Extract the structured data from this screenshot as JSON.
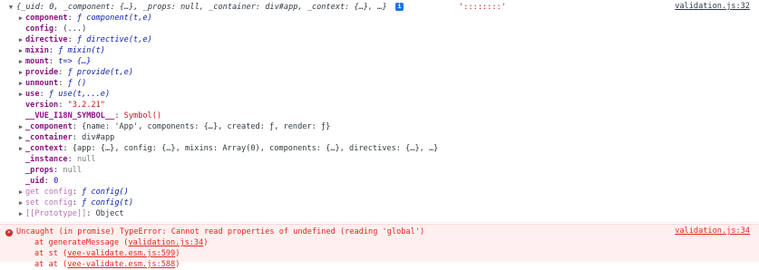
{
  "summary": {
    "text": "{_uid: 0, _component: {…}, _props: null, _container: div#app, _context: {…}, …}",
    "info_badge": "i",
    "trailing": "'::::::::'",
    "source": "validation.js:32"
  },
  "props": [
    {
      "key": "component",
      "value": "ƒ component(t,e)",
      "arrow": "▶",
      "kind": "func"
    },
    {
      "key": "config",
      "value": "(...)",
      "arrow": "",
      "kind": "plain"
    },
    {
      "key": "directive",
      "value": "ƒ directive(t,e)",
      "arrow": "▶",
      "kind": "func"
    },
    {
      "key": "mixin",
      "value": "ƒ mixin(t)",
      "arrow": "▶",
      "kind": "func"
    },
    {
      "key": "mount",
      "value": "t=> {…}",
      "arrow": "▶",
      "kind": "func"
    },
    {
      "key": "provide",
      "value": "ƒ provide(t,e)",
      "arrow": "▶",
      "kind": "func"
    },
    {
      "key": "unmount",
      "value": "ƒ ()",
      "arrow": "▶",
      "kind": "func"
    },
    {
      "key": "use",
      "value": "ƒ use(t,...e)",
      "arrow": "▶",
      "kind": "func"
    },
    {
      "key": "version",
      "value": "\"3.2.21\"",
      "arrow": "",
      "kind": "str"
    },
    {
      "key": "__VUE_I18N_SYMBOL__",
      "value": "Symbol()",
      "arrow": "",
      "kind": "sym"
    },
    {
      "key": "_component",
      "value": "{name: 'App', components: {…}, created: ƒ, render: ƒ}",
      "arrow": "▶",
      "kind": "plain"
    },
    {
      "key": "_container",
      "value": "div#app",
      "arrow": "▶",
      "kind": "plain"
    },
    {
      "key": "_context",
      "value": "{app: {…}, config: {…}, mixins: Array(0), components: {…}, directives: {…}, …}",
      "arrow": "▶",
      "kind": "plain"
    },
    {
      "key": "_instance",
      "value": "null",
      "arrow": "",
      "kind": "null"
    },
    {
      "key": "_props",
      "value": "null",
      "arrow": "",
      "kind": "null"
    },
    {
      "key": "_uid",
      "value": "0",
      "arrow": "",
      "kind": "num"
    },
    {
      "key": "get config",
      "value": "ƒ config()",
      "arrow": "▶",
      "kind": "getter"
    },
    {
      "key": "set config",
      "value": "ƒ config(t)",
      "arrow": "▶",
      "kind": "getter"
    },
    {
      "key": "[[Prototype]]",
      "value": "Object",
      "arrow": "▶",
      "kind": "proto"
    }
  ],
  "error": {
    "message": "Uncaught (in promise) TypeError: Cannot read properties of undefined (reading 'global')",
    "icon": "✕",
    "source": "validation.js:34",
    "stack": [
      {
        "prefix": "at generateMessage (",
        "link": "validation.js:34",
        "suffix": ")"
      },
      {
        "prefix": "at st (",
        "link": "vee-validate.esm.js:599",
        "suffix": ")"
      },
      {
        "prefix": "at at (",
        "link": "vee-validate.esm.js:588",
        "suffix": ")"
      }
    ]
  }
}
